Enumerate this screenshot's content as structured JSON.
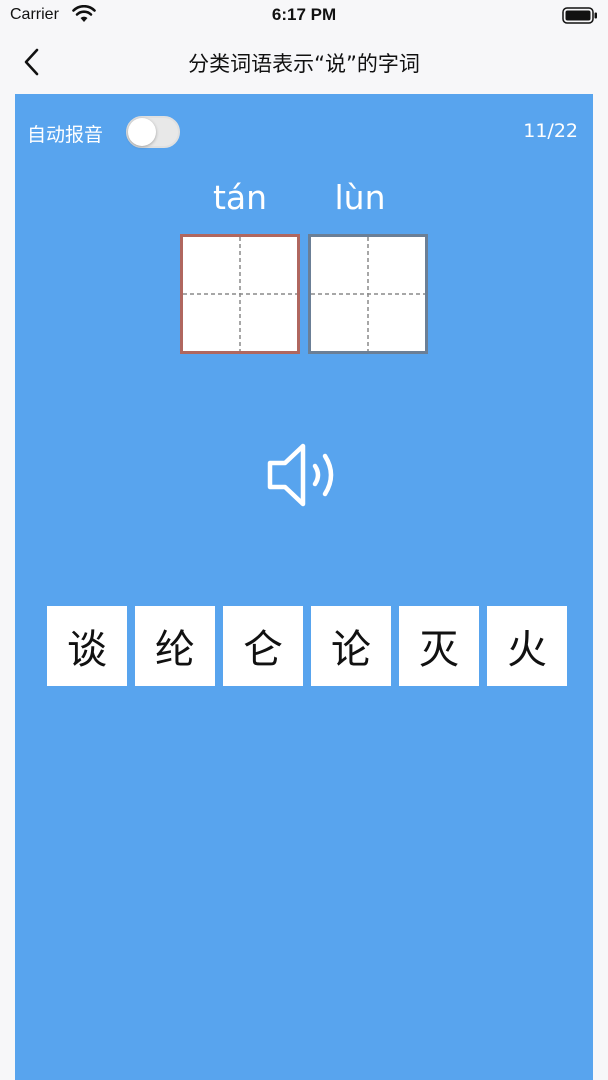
{
  "status_bar": {
    "carrier": "Carrier",
    "time": "6:17 PM"
  },
  "nav": {
    "title": "分类词语表示“说”的字词",
    "back_icon": "chevron-left-icon"
  },
  "quiz": {
    "auto_audio_label": "自动报音",
    "auto_audio_enabled": false,
    "progress": "11/22",
    "pinyin": [
      "tán",
      "lùn"
    ],
    "speaker_icon": "speaker-icon",
    "choices": [
      "谈",
      "纶",
      "仑",
      "论",
      "灭",
      "火"
    ]
  },
  "colors": {
    "card_background": "#58a4ee",
    "page_background": "#f7f7f9",
    "active_box_border": "#b0675f",
    "inactive_box_border": "#6b7f96"
  }
}
